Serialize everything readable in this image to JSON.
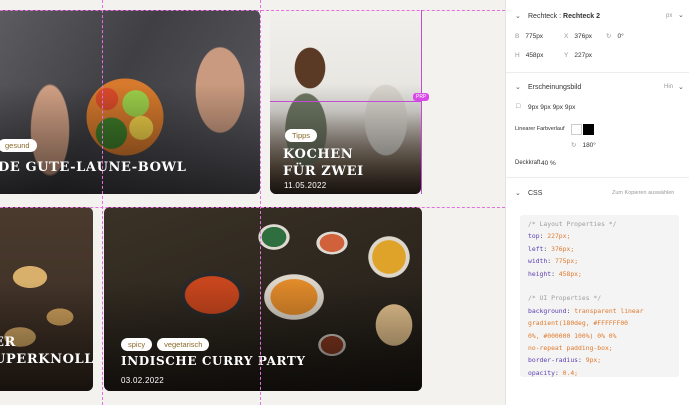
{
  "cards": {
    "bowl": {
      "tags": [
        "gesund"
      ],
      "title": "DE GUTE-LAUNE-BOWL"
    },
    "kochen": {
      "tags": [
        "Tipps"
      ],
      "title": "KOCHEN\nFÜR ZWEI",
      "date": "11.05.2022"
    },
    "ingwer": {
      "title": "ER\nUPERKNOLLE"
    },
    "curry": {
      "tags": [
        "spicy",
        "vegetarisch"
      ],
      "title": "INDISCHE CURRY PARTY",
      "date": "03.02.2022"
    }
  },
  "canvas": {
    "selection_badge": "PRP"
  },
  "inspector": {
    "rect": {
      "prefix": "Rechteck :",
      "name": "Rechteck 2",
      "unit": "px",
      "fields": [
        {
          "key": "B",
          "value": "775px"
        },
        {
          "key": "X",
          "value": "376px"
        },
        {
          "key": "rotate",
          "value": "0°"
        },
        {
          "key": "H",
          "value": "458px"
        },
        {
          "key": "Y",
          "value": "227px"
        }
      ]
    },
    "appearance": {
      "title": "Erscheinungsbild",
      "mode": "Hin",
      "radius": "9px  9px  9px  9px",
      "gradient_label": "Linearer Farbverlauf",
      "gradient_colors": [
        "#ffffff",
        "#000000"
      ],
      "angle": "180°",
      "opacity_label": "Deckkraft",
      "opacity_value": "40 %"
    },
    "css": {
      "title": "CSS",
      "copy_hint": "Zum Kopieren auswählen",
      "layout_comment": "/* Layout Properties */",
      "layout": [
        {
          "prop": "top",
          "val": "227px;"
        },
        {
          "prop": "left",
          "val": "376px;"
        },
        {
          "prop": "width",
          "val": "775px;"
        },
        {
          "prop": "height",
          "val": "458px;"
        }
      ],
      "ui_comment": "/* UI Properties */",
      "background_prop": "background",
      "background_val": "transparent linear gradient(180deg, #FFFFFF00 0%, #000000 100%) 0% 0% no-repeat padding-box;",
      "ui": [
        {
          "prop": "border-radius",
          "val": "9px;"
        },
        {
          "prop": "opacity",
          "val": "0.4;"
        }
      ]
    }
  }
}
